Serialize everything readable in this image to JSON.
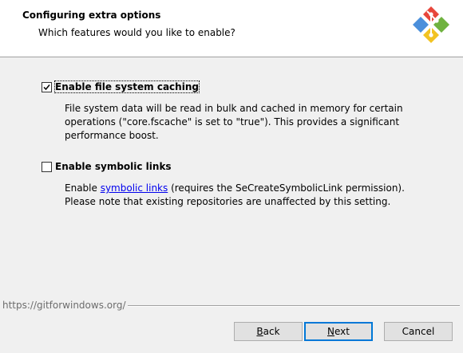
{
  "header": {
    "title": "Configuring extra options",
    "subtitle": "Which features would you like to enable?"
  },
  "options": [
    {
      "label": "Enable file system caching",
      "checked": true,
      "description_lines": [
        "File system data will be read in bulk and cached in memory for certain",
        "operations (\"core.fscache\" is set to \"true\"). This provides a significant",
        "performance boost."
      ]
    },
    {
      "label": "Enable symbolic links",
      "checked": false,
      "description_prefix": "Enable ",
      "description_link": "symbolic links",
      "description_suffix": " (requires the SeCreateSymbolicLink permission).",
      "description_line2": "Please note that existing repositories are unaffected by this setting."
    }
  ],
  "footer": {
    "url": "https://gitforwindows.org/"
  },
  "buttons": {
    "back_mnemonic": "B",
    "back_rest": "ack",
    "next_mnemonic": "N",
    "next_rest": "ext",
    "cancel": "Cancel"
  },
  "colors": {
    "logo_red": "#e8463b",
    "logo_green": "#6fb23f",
    "logo_blue": "#4b8fdb",
    "logo_yellow": "#f2c322",
    "link": "#0000ee",
    "default_button_border": "#0078d7"
  },
  "icons": {
    "logo": "git-for-windows-logo",
    "check": "checkmark-icon"
  }
}
